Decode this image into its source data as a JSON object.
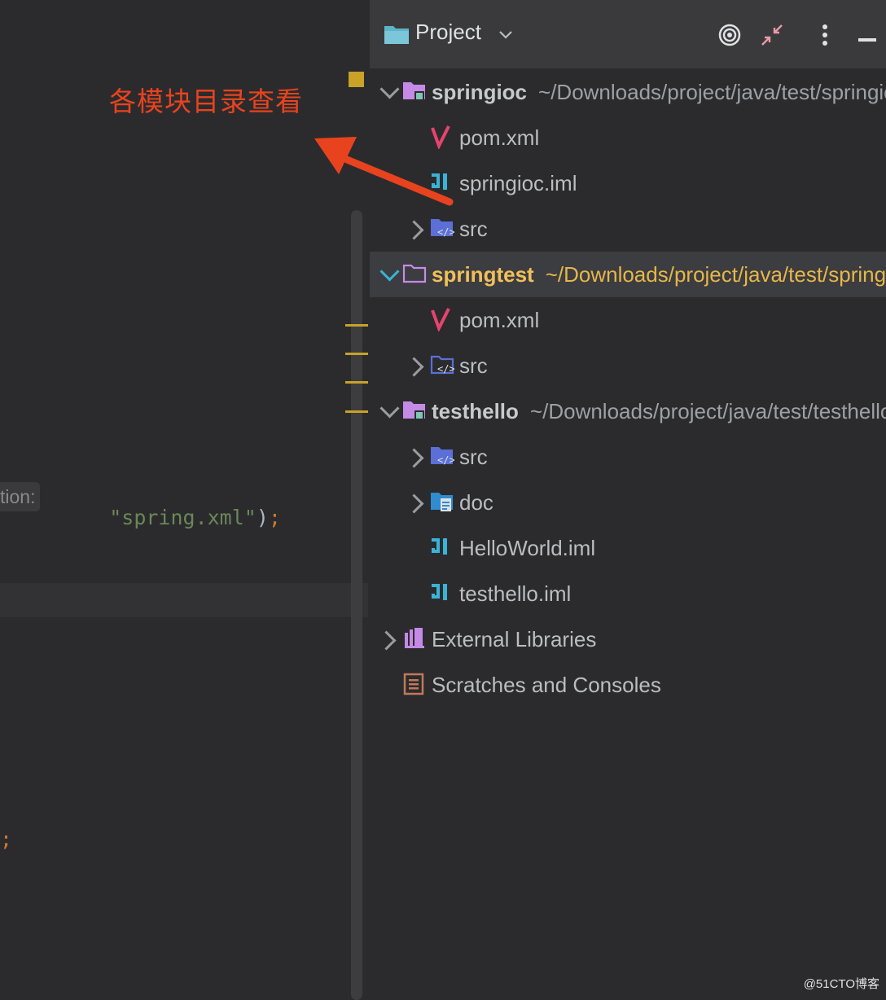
{
  "editor": {
    "hint_text": "tion:",
    "string_literal": "\"spring.xml\"",
    "close_paren": ")",
    "semicolon": ";",
    "lower_semicolon": ";"
  },
  "annotation": {
    "text": "各模块目录查看",
    "color": "#e8431e"
  },
  "panel": {
    "title": "Project",
    "toolbar_icons": [
      "locate-icon",
      "collapse-icon",
      "more-icon",
      "minimize-icon"
    ]
  },
  "tree": [
    {
      "name": "springioc",
      "path": "~/Downloads/project/java/test/springioc",
      "type": "module",
      "expanded": true
    },
    {
      "name": "pom.xml",
      "type": "maven-file"
    },
    {
      "name": "springioc.iml",
      "type": "iml-file"
    },
    {
      "name": "src",
      "type": "source-folder",
      "expanded": false
    },
    {
      "name": "springtest",
      "path": "~/Downloads/project/java/test/springtest",
      "type": "module",
      "expanded": true,
      "selected": true
    },
    {
      "name": "pom.xml",
      "type": "maven-file"
    },
    {
      "name": "src",
      "type": "source-folder",
      "expanded": false
    },
    {
      "name": "testhello",
      "path": "~/Downloads/project/java/test/testhello",
      "type": "module",
      "expanded": true
    },
    {
      "name": "src",
      "type": "source-folder",
      "expanded": false
    },
    {
      "name": "doc",
      "type": "doc-folder",
      "expanded": false
    },
    {
      "name": "HelloWorld.iml",
      "type": "iml-file"
    },
    {
      "name": "testhello.iml",
      "type": "iml-file"
    },
    {
      "name": "External Libraries",
      "type": "libraries",
      "expanded": false
    },
    {
      "name": "Scratches and Consoles",
      "type": "scratches"
    }
  ],
  "watermark": "@51CTO博客"
}
